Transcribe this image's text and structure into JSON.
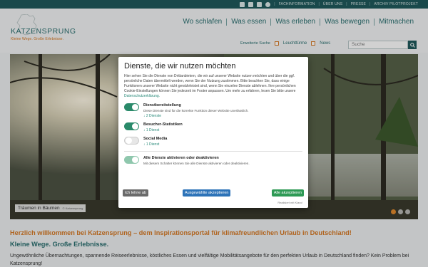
{
  "topbar": {
    "social_icons": [
      "facebook-icon",
      "instagram-icon",
      "youtube-icon",
      "x-icon"
    ],
    "links": [
      "FACHINFORMATION",
      "ÜBER UNS",
      "PRESSE",
      "ARCHIV PILOTPROJEKT"
    ]
  },
  "logo": {
    "name": "KATZENSPRUNG",
    "slogan": "Kleine Wege. Große Erlebnisse."
  },
  "nav": {
    "items": [
      "Wo schlafen",
      "Was essen",
      "Was erleben",
      "Was bewegen",
      "Mitmachen"
    ]
  },
  "subnav": {
    "erweiterte_suche": "Erweiterte Suche",
    "option1": "Leuchttürme",
    "option2": "News",
    "search_placeholder": "Suche"
  },
  "hero": {
    "caption_title": "Träumen in Bäumen",
    "caption_credit": "© Katzensprung"
  },
  "modal": {
    "title": "Dienste, die wir nutzen möchten",
    "intro": "Hier sehen Sie die Dienste von Drittanbietern, die wir auf unserer Website nutzen möchten und über die ggf. persönliche Daten übermittelt werden, wenn Sie der Nutzung zustimmen. Bitte beachten Sie, dass einige Funktionen unserer Website nicht gewährleistet sind, wenn Sie einzelne Dienste ablehnen. Ihre persönlichen Cookie-Einstellungen können Sie jederzeit im Footer anpassen. Um mehr zu erfahren, lesen Sie bitte unsere",
    "intro_link": "Datenschutzerklärung.",
    "services": [
      {
        "title": "Dienstbereitstellung",
        "desc": "Diese Dienste sind für die korrekte Funktion dieser Website unerlässlich.",
        "count": "↓ 2 Dienste",
        "enabled": true
      },
      {
        "title": "Besucher-Statistiken",
        "desc": "",
        "count": "↓ 1 Dienst",
        "enabled": true
      },
      {
        "title": "Social Media",
        "desc": "",
        "count": "↓ 1 Dienst",
        "enabled": false
      }
    ],
    "all_title": "Alle Dienste aktivieren oder deaktivieren",
    "all_desc": "Mit diesem Schalter können Sie alle Dienste aktivieren oder deaktivieren.",
    "btn_decline": "Ich lehne ab",
    "btn_selected": "Ausgewählte akzeptieren",
    "btn_all": "Alle akzeptieren",
    "realized": "Realisiert mit Klaro!"
  },
  "content": {
    "welcome": "Herzlich willkommen bei Katzensprung – dem Inspirationsportal für klimafreundlichen Urlaub in Deutschland!",
    "subhead": "Kleine Wege. Große Erlebnisse.",
    "para": "Ungewöhnliche Übernachtungen, spannende Reiseerlebnisse, köstliches Essen und vielfältige Mobilitätsangebote für den perfekten Urlaub in Deutschland finden? Kein Problem bei Katzensprung!"
  },
  "colors": {
    "brand_teal": "#1f5a5c",
    "accent_orange": "#d77a26",
    "toggle_on": "#2a8a6a"
  }
}
